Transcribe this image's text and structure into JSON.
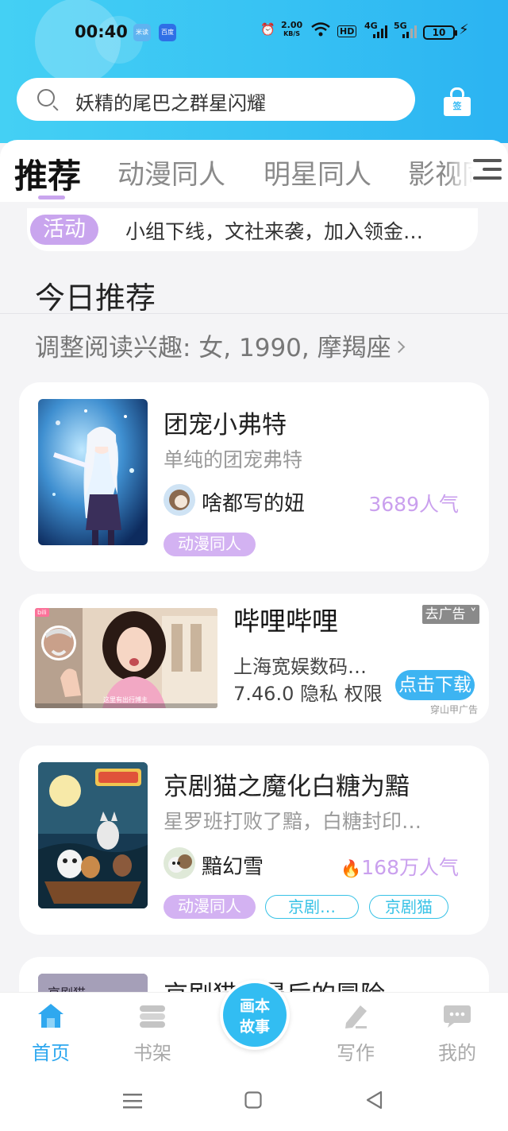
{
  "status_bar": {
    "time": "00:40",
    "app_icons": [
      "米读",
      "百度"
    ],
    "net_speed_value": "2.00",
    "net_speed_unit": "KB/S",
    "hd": "HD",
    "signal_1": "4G",
    "signal_2": "5G",
    "battery": "10"
  },
  "header": {
    "search_text": "妖精的尾巴之群星闪耀",
    "checkin_label": "签",
    "accent_color": "#37c2f3"
  },
  "tabs": [
    {
      "label": "推荐",
      "active": true
    },
    {
      "label": "动漫同人",
      "active": false
    },
    {
      "label": "明星同人",
      "active": false
    },
    {
      "label": "影视同人",
      "active": false
    }
  ],
  "notice": {
    "tag": "活动",
    "text": "小组下线，文社来袭，加入领金…"
  },
  "recommend": {
    "title": "今日推荐",
    "interest": "调整阅读兴趣: 女, 1990, 摩羯座"
  },
  "books": [
    {
      "title": "团宠小弗特",
      "desc": "单纯的团宠弗特",
      "author": "啥都写的妞",
      "popularity": "3689人气",
      "hot": false,
      "tags": [
        {
          "label": "动漫同人",
          "style": "fill"
        }
      ]
    },
    {
      "title": "京剧猫之魔化白糖为黯",
      "desc": "星罗班打败了黯，白糖封印…",
      "author": "黯幻雪",
      "popularity": "168万人气",
      "hot": true,
      "tags": [
        {
          "label": "动漫同人",
          "style": "fill"
        },
        {
          "label": "京剧…",
          "style": "line"
        },
        {
          "label": "京剧猫",
          "style": "line"
        }
      ]
    },
    {
      "title": "京剧猫之暴后的冒险",
      "desc": "",
      "author": "",
      "popularity": "",
      "hot": false,
      "tags": []
    }
  ],
  "ad": {
    "title": "哔哩哔哩",
    "close_label": "去广告",
    "company": "上海宽娱数码…",
    "version": "7.46.0",
    "privacy": "隐私",
    "permission": "权限",
    "download_label": "点击下载",
    "source": "穿山甲广告",
    "video_caption": "这里有出行博主",
    "app_badge": "bili"
  },
  "bottom_nav": {
    "items": [
      {
        "label": "首页",
        "icon": "home-icon",
        "active": true
      },
      {
        "label": "书架",
        "icon": "bookshelf-icon",
        "active": false
      },
      {
        "label": "写作",
        "icon": "pen-icon",
        "active": false
      },
      {
        "label": "我的",
        "icon": "chat-bubble-icon",
        "active": false
      }
    ],
    "center_line1": "画本",
    "center_line2": "故事"
  }
}
